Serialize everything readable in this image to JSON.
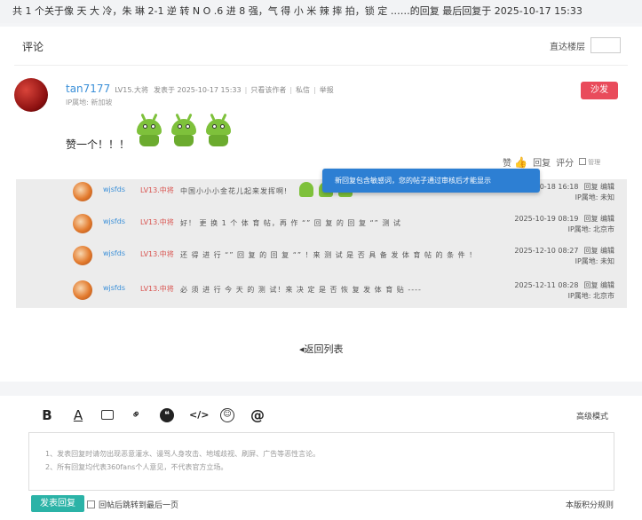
{
  "top_bar": {
    "text": "共 1 个关于像 天 大 冷，朱 琳 2-1 逆 转 N O .6 进 8 强，气 得 小 米 辣 摔 拍，锁 定 ……的回复 最后回复于 2025-10-17 15:33"
  },
  "comments_section": {
    "title": "评论",
    "jump_label": "直达楼层"
  },
  "main_post": {
    "author": "tan7177",
    "level": "LV15.大将",
    "posted": "发表于 2025-10-17 15:33",
    "view_author_only": "只看该作者",
    "private_msg": "私信",
    "report": "举报",
    "sep": "|",
    "ip": "IP属地: 新加坡",
    "sofa": "沙发",
    "text": "赞一个！！！",
    "actions": {
      "like": "赞",
      "reply": "回复",
      "rate": "评分",
      "manage": "管理"
    }
  },
  "replies": [
    {
      "name": "wjsfds",
      "level": "LV13.中将",
      "text": "中国小小小金花儿起来发挥啊!",
      "time": "2025-10-18 16:18",
      "reply": "回复",
      "edit": "编辑",
      "ip": "IP属地: 未知"
    },
    {
      "name": "wjsfds",
      "level": "LV13.中将",
      "text": "好！ 更 换 1 个 体 育 帖，再 作 “” 回 复 的 回 复 “” 测 试",
      "time": "2025-10-19 08:19",
      "reply": "回复",
      "edit": "编辑",
      "ip": "IP属地: 北京市"
    },
    {
      "name": "wjsfds",
      "level": "LV13.中将",
      "text": "还 得 进 行 “” 回 复 的 回 复 “” ！来 测 试 是 否 具 备 发 体 育 帖 的 条 件 ！",
      "time": "2025-12-10 08:27",
      "reply": "回复",
      "edit": "编辑",
      "ip": "IP属地: 未知"
    },
    {
      "name": "wjsfds",
      "level": "LV13.中将",
      "text": "必 须 进 行 今 天 的 测 试！来 决 定 是 否 恢 复 发 体 育 贴 ----",
      "time": "2025-12-11 08:28",
      "reply": "回复",
      "edit": "编辑",
      "ip": "IP属地: 北京市"
    }
  ],
  "toast": {
    "text": "新回复包含敏感词，您的帖子通过审核后才能显示"
  },
  "back_to_list": "返回列表",
  "editor": {
    "advanced_mode": "高级模式",
    "tips": [
      "1、发表回复时请勿出现恶意灌水、谩骂人身攻击、地域歧视、刷屏、广告等恶性言论。",
      "2、所有回复均代表360fans个人意见，不代表官方立场。"
    ],
    "submit": "发表回复",
    "jump_last": "回帖后跳转到最后一页",
    "rules": "本版积分规则",
    "tool_bold": "B",
    "tool_font_color": "A",
    "tool_code": "</>",
    "tool_emoji": "☺",
    "tool_at": "@"
  },
  "icons": [
    "bold-icon",
    "font-color-icon",
    "image-icon",
    "link-icon",
    "quote-icon",
    "code-icon",
    "emoji-icon",
    "at-icon",
    "thumb-up-icon",
    "back-arrow-icon"
  ]
}
